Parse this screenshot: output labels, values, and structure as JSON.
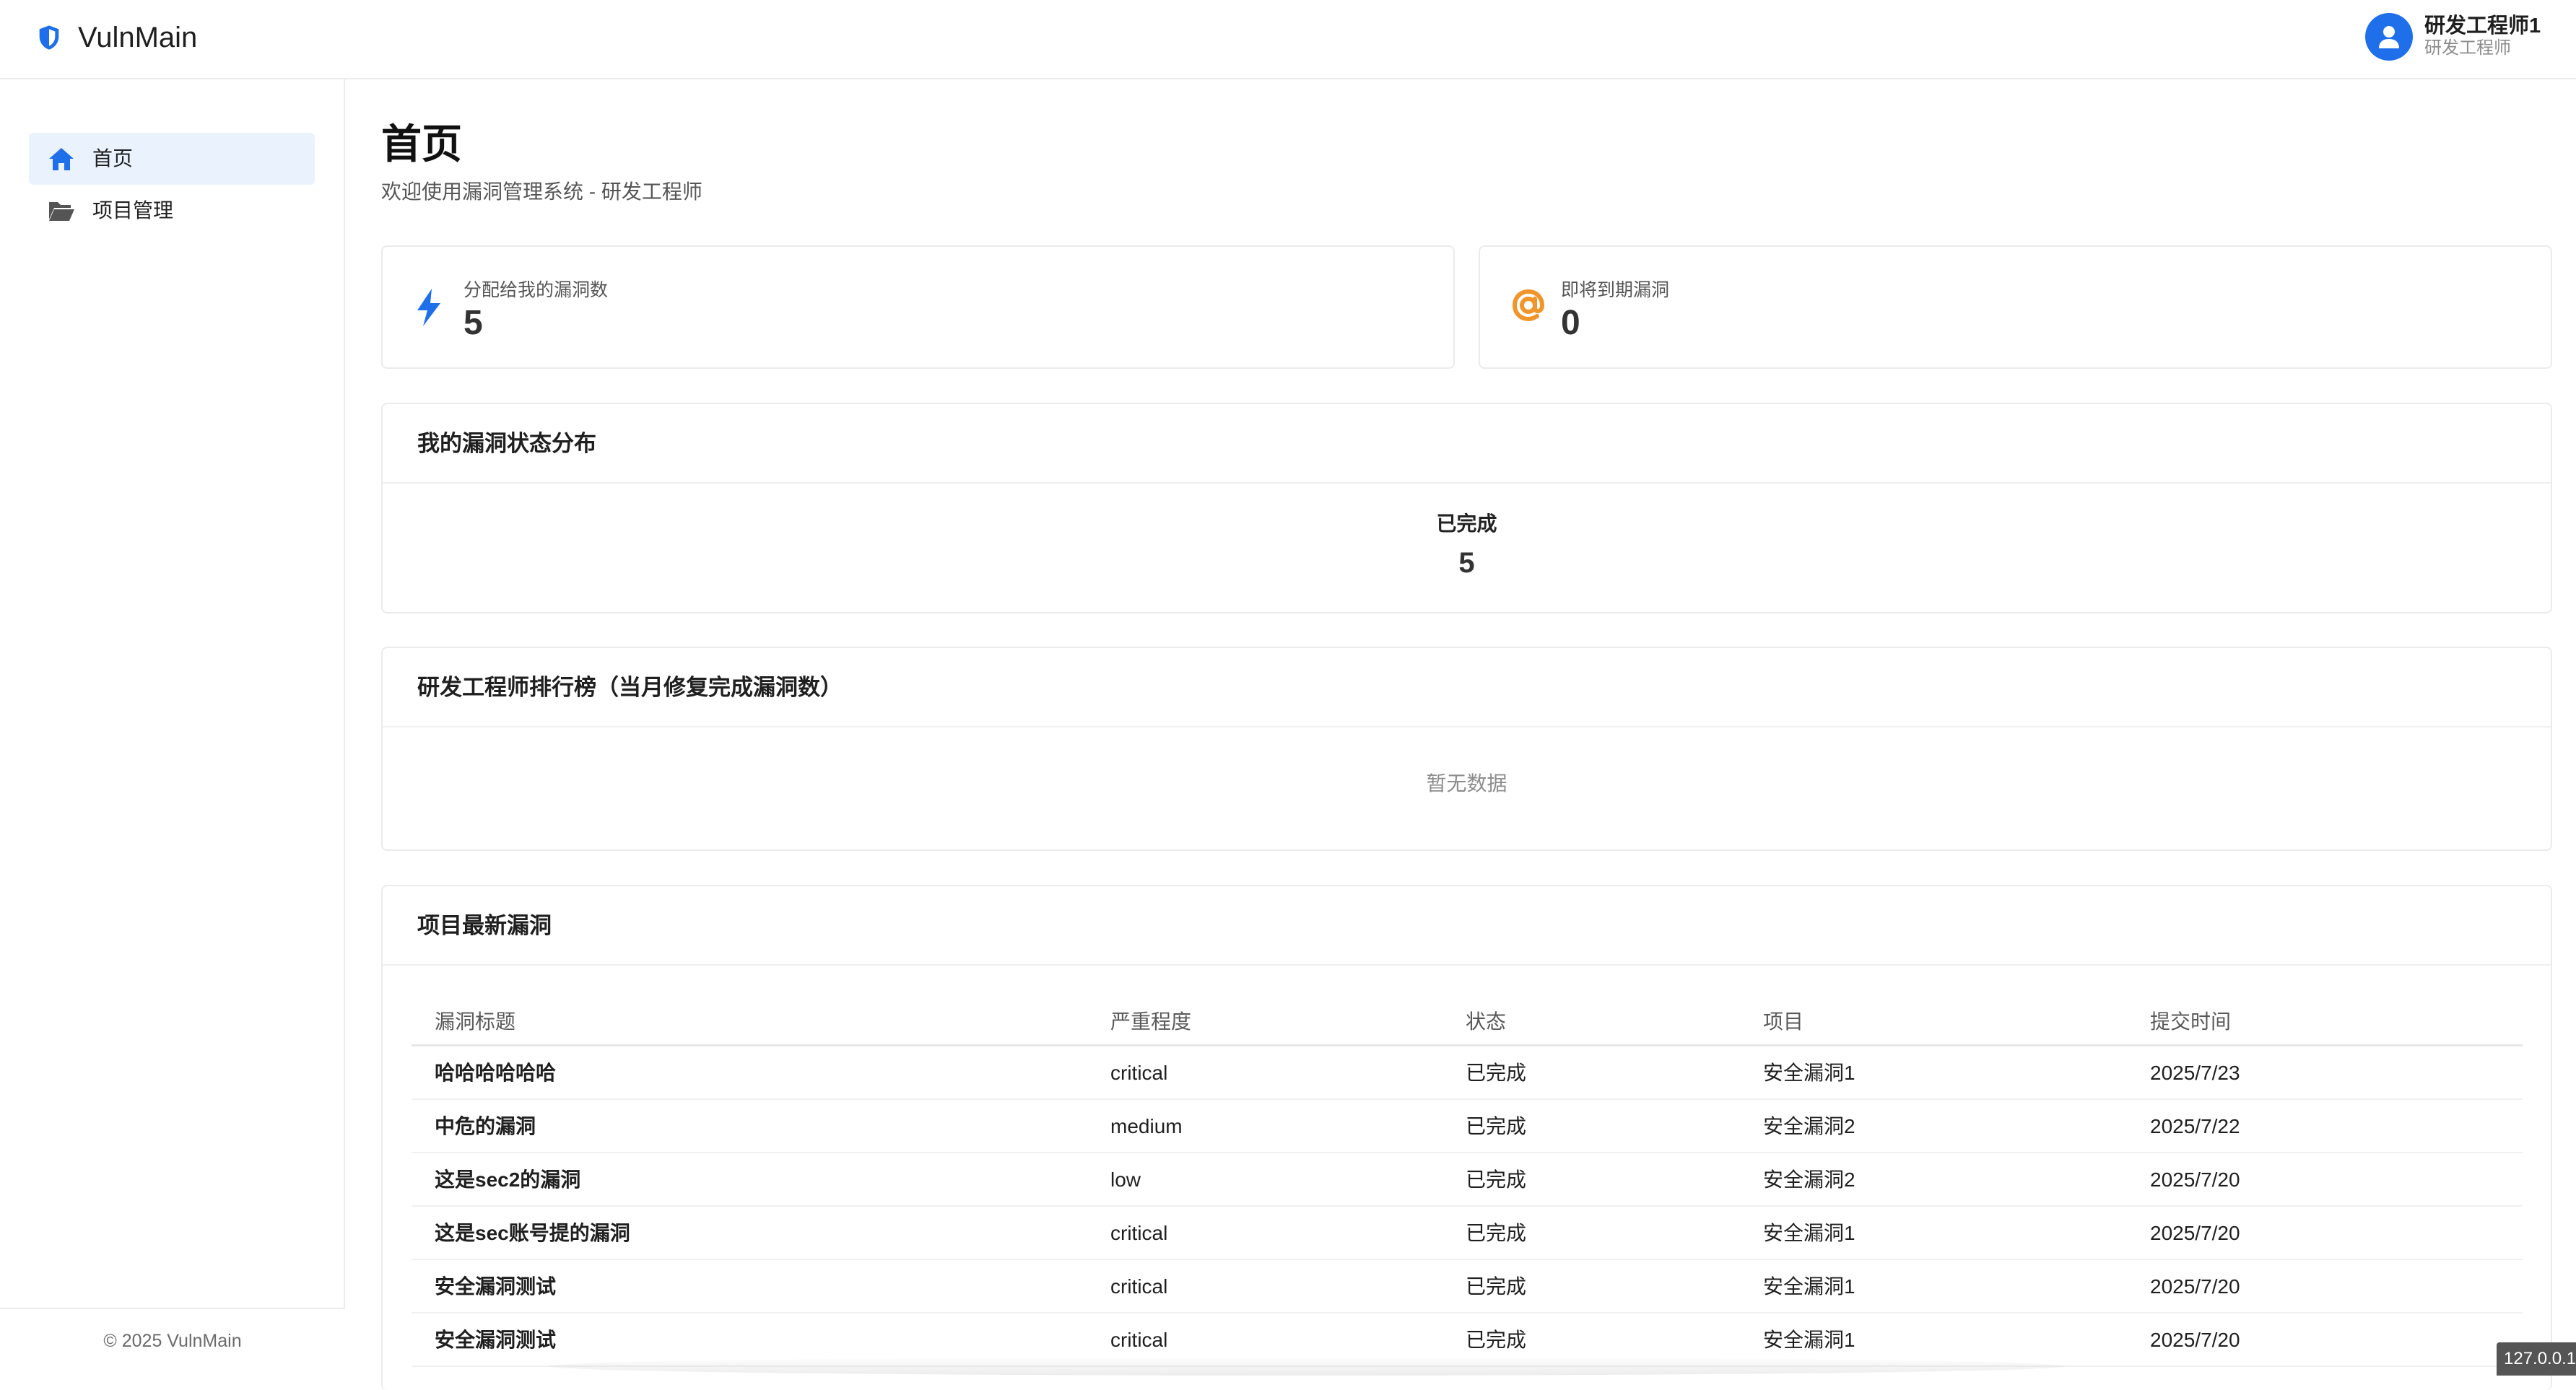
{
  "app": {
    "name": "VulnMain",
    "logo_icon": "shield-icon"
  },
  "user": {
    "name": "研发工程师1",
    "role": "研发工程师",
    "avatar_icon": "user-icon"
  },
  "sidebar": {
    "items": [
      {
        "label": "首页",
        "icon": "home-icon",
        "active": true
      },
      {
        "label": "项目管理",
        "icon": "folder-open-icon",
        "active": false
      }
    ],
    "footer": "© 2025 VulnMain"
  },
  "page": {
    "title": "首页",
    "subtitle": "欢迎使用漏洞管理系统 - 研发工程师"
  },
  "stats": [
    {
      "label": "分配给我的漏洞数",
      "value": "5",
      "icon": "bolt-icon",
      "color": "#1f6feb"
    },
    {
      "label": "即将到期漏洞",
      "value": "0",
      "icon": "at-icon",
      "color": "#f0952b"
    }
  ],
  "distribution": {
    "title": "我的漏洞状态分布",
    "items": [
      {
        "label": "已完成",
        "value": "5"
      }
    ]
  },
  "leaderboard": {
    "title": "研发工程师排行榜（当月修复完成漏洞数）",
    "empty_text": "暂无数据"
  },
  "latest": {
    "title": "项目最新漏洞",
    "columns": [
      "漏洞标题",
      "严重程度",
      "状态",
      "项目",
      "提交时间"
    ],
    "rows": [
      [
        "哈哈哈哈哈哈",
        "critical",
        "已完成",
        "安全漏洞1",
        "2025/7/23"
      ],
      [
        "中危的漏洞",
        "medium",
        "已完成",
        "安全漏洞2",
        "2025/7/22"
      ],
      [
        "这是sec2的漏洞",
        "low",
        "已完成",
        "安全漏洞2",
        "2025/7/20"
      ],
      [
        "这是sec账号提的漏洞",
        "critical",
        "已完成",
        "安全漏洞1",
        "2025/7/20"
      ],
      [
        "安全漏洞测试",
        "critical",
        "已完成",
        "安全漏洞1",
        "2025/7/20"
      ],
      [
        "安全漏洞测试",
        "critical",
        "已完成",
        "安全漏洞1",
        "2025/7/20"
      ]
    ]
  },
  "ip_badge": "127.0.0.1",
  "colors": {
    "accent": "#1f6feb",
    "active_bg": "#eaf2fe",
    "warning": "#f0952b"
  }
}
